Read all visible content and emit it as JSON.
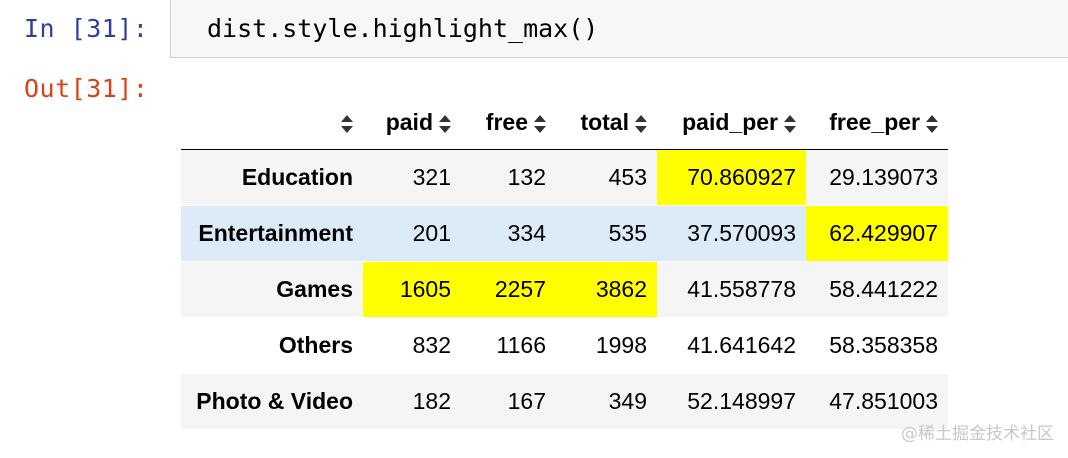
{
  "input": {
    "prompt": "In [31]:",
    "code": "dist.style.highlight_max()"
  },
  "output": {
    "prompt": "Out[31]:"
  },
  "table": {
    "columns": [
      "paid",
      "free",
      "total",
      "paid_per",
      "free_per"
    ],
    "rows": [
      {
        "index": "Education",
        "paid": "321",
        "free": "132",
        "total": "453",
        "paid_per": "70.860927",
        "free_per": "29.139073"
      },
      {
        "index": "Entertainment",
        "paid": "201",
        "free": "334",
        "total": "535",
        "paid_per": "37.570093",
        "free_per": "62.429907"
      },
      {
        "index": "Games",
        "paid": "1605",
        "free": "2257",
        "total": "3862",
        "paid_per": "41.558778",
        "free_per": "58.441222"
      },
      {
        "index": "Others",
        "paid": "832",
        "free": "1166",
        "total": "1998",
        "paid_per": "41.641642",
        "free_per": "58.358358"
      },
      {
        "index": "Photo & Video",
        "paid": "182",
        "free": "167",
        "total": "349",
        "paid_per": "52.148997",
        "free_per": "47.851003"
      }
    ],
    "highlight_color": "#ffff00",
    "hover_row_color": "#dcebf8"
  },
  "watermark": "@稀土掘金技术社区"
}
